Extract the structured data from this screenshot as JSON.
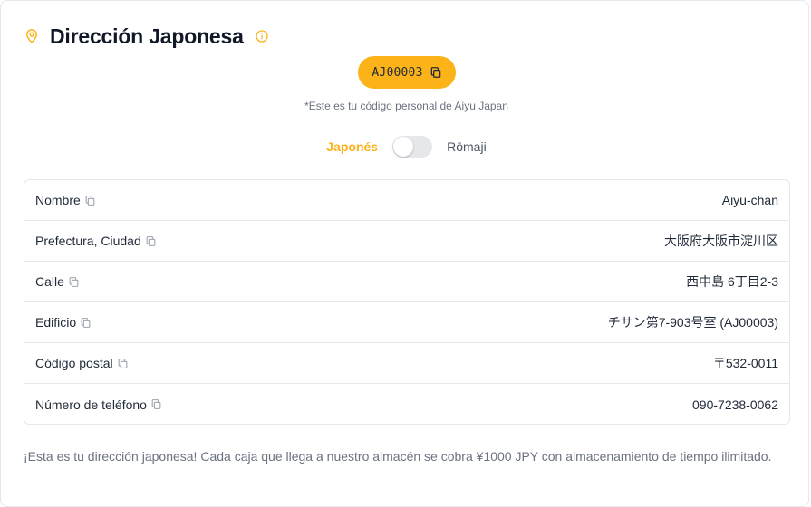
{
  "header": {
    "title": "Dirección Japonesa",
    "pin_icon": "map-pin-icon",
    "info_icon": "info-icon",
    "accent_color": "#fbb319"
  },
  "code": {
    "value": "AJ00003",
    "note": "*Este es tu código personal de Aiyu Japan"
  },
  "toggle": {
    "left_label": "Japonés",
    "right_label": "Rōmaji",
    "state": "off"
  },
  "rows": [
    {
      "label": "Nombre",
      "value": "Aiyu-chan"
    },
    {
      "label": "Prefectura, Ciudad",
      "value": "大阪府大阪市淀川区"
    },
    {
      "label": "Calle",
      "value": "西中島 6丁目2-3"
    },
    {
      "label": "Edificio",
      "value": "チサン第7-903号室 (AJ00003)"
    },
    {
      "label": "Código postal",
      "value": "〒532-0011"
    },
    {
      "label": "Número de teléfono",
      "value": "090-7238-0062"
    }
  ],
  "footer": {
    "text": "¡Esta es tu dirección japonesa! Cada caja que llega a nuestro almacén se cobra ¥1000 JPY con almacenamiento de tiempo ilimitado."
  }
}
